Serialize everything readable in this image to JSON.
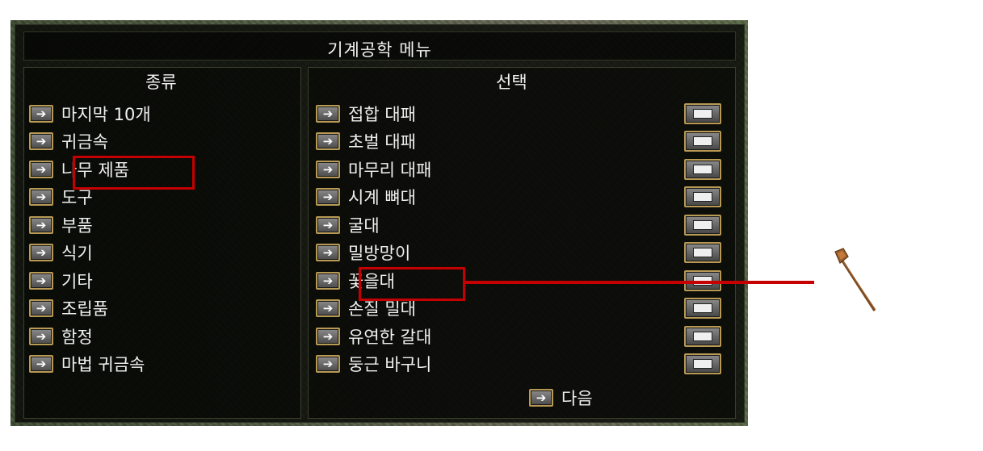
{
  "window": {
    "title": "기계공학 메뉴"
  },
  "categories": {
    "header": "종류",
    "items": [
      {
        "label": "마지막 10개"
      },
      {
        "label": "귀금속"
      },
      {
        "label": "나무 제품"
      },
      {
        "label": "도구"
      },
      {
        "label": "부품"
      },
      {
        "label": "식기"
      },
      {
        "label": "기타"
      },
      {
        "label": "조립품"
      },
      {
        "label": "함정"
      },
      {
        "label": "마법 귀금속"
      }
    ]
  },
  "selections": {
    "header": "선택",
    "items": [
      {
        "label": "접합 대패"
      },
      {
        "label": "초벌 대패"
      },
      {
        "label": "마무리 대패"
      },
      {
        "label": "시계 뼈대"
      },
      {
        "label": "굴대"
      },
      {
        "label": "밀방망이"
      },
      {
        "label": "꽃을대"
      },
      {
        "label": "손질 밀대"
      },
      {
        "label": "유연한 갈대"
      },
      {
        "label": "둥근 바구니"
      }
    ],
    "next_label": "다음"
  },
  "icons": {
    "select_button": "arrow-right-icon",
    "detail_button": "detail-page-icon",
    "item_preview": "wooden-tool-icon"
  },
  "colors": {
    "highlight": "#c60000",
    "button_border": "#b89a55",
    "text": "#f0f0f0"
  }
}
